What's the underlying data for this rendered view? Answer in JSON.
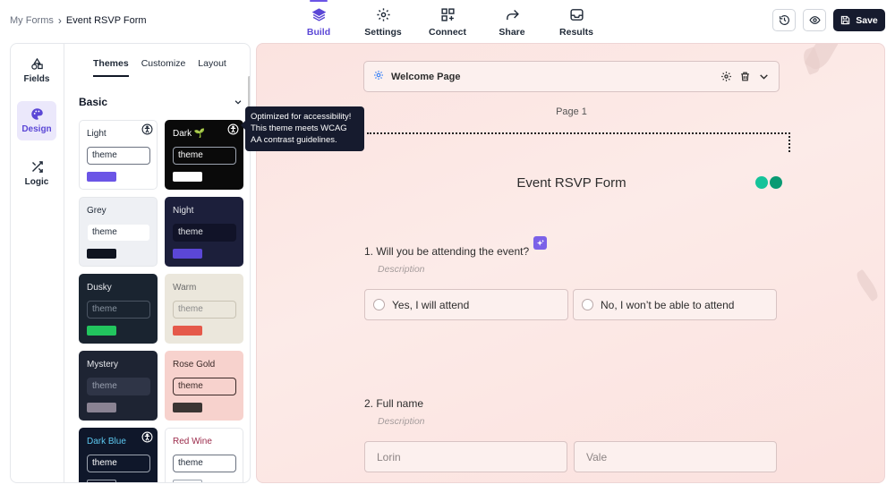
{
  "breadcrumb": {
    "root": "My Forms",
    "separator": "›",
    "current": "Event RSVP Form"
  },
  "nav": {
    "tabs": [
      {
        "label": "Build",
        "icon": "layers-icon",
        "active": true
      },
      {
        "label": "Settings",
        "icon": "gear-icon"
      },
      {
        "label": "Connect",
        "icon": "grid-plus-icon"
      },
      {
        "label": "Share",
        "icon": "share-arrow-icon"
      },
      {
        "label": "Results",
        "icon": "inbox-icon"
      }
    ]
  },
  "actions": {
    "history_icon": "history-icon",
    "preview_icon": "eye-icon",
    "save_label": "Save"
  },
  "rail": {
    "items": [
      {
        "label": "Fields",
        "icon": "shapes-icon"
      },
      {
        "label": "Design",
        "icon": "palette-icon",
        "active": true
      },
      {
        "label": "Logic",
        "icon": "shuffle-icon"
      }
    ]
  },
  "subtabs": [
    {
      "label": "Themes",
      "active": true
    },
    {
      "label": "Customize"
    },
    {
      "label": "Layout"
    }
  ],
  "section": {
    "title": "Basic"
  },
  "themes": [
    {
      "name": "Light",
      "input": "theme",
      "accessible": true,
      "bg": "#ffffff",
      "text": "#1f2937",
      "input_bg": "#ffffff",
      "input_border": "#6b7280",
      "input_text": "#1f2937",
      "swatch": "#6b55e6"
    },
    {
      "name": "Dark 🌱",
      "input": "theme",
      "accessible": true,
      "bg": "#0a0a0a",
      "text": "#ffffff",
      "input_bg": "#0a0a0a",
      "input_border": "#9ca3af",
      "input_text": "#ffffff",
      "swatch": "#ffffff"
    },
    {
      "name": "Grey",
      "input": "theme",
      "bg": "#eef0f4",
      "text": "#1f2937",
      "input_bg": "#ffffff",
      "input_border": "#eef0f4",
      "input_text": "#1f2937",
      "swatch": "#0f1420"
    },
    {
      "name": "Night",
      "input": "theme",
      "bg": "#1c1f3b",
      "text": "#e5e7eb",
      "input_bg": "#111328",
      "input_border": "#111328",
      "input_text": "#e5e7eb",
      "swatch": "#5b47d6"
    },
    {
      "name": "Dusky",
      "input": "theme",
      "bg": "#1a2430",
      "text": "#e5e7eb",
      "input_bg": "#1a2430",
      "input_border": "#4b5563",
      "input_text": "#8893a0",
      "swatch": "#22c55e"
    },
    {
      "name": "Warm",
      "input": "theme",
      "bg": "#ebe7dc",
      "text": "#6b6b6b",
      "input_bg": "#ebe7dc",
      "input_border": "#c9c3b4",
      "input_text": "#8a8a8a",
      "swatch": "#e5594a"
    },
    {
      "name": "Mystery",
      "input": "theme",
      "bg": "#1e2433",
      "text": "#e5e7eb",
      "input_bg": "#2f3547",
      "input_border": "#2f3547",
      "input_text": "#9aa1b0",
      "swatch": "#8a8393"
    },
    {
      "name": "Rose Gold",
      "input": "theme",
      "bg": "#f7d2cd",
      "text": "#3b2a28",
      "input_bg": "#f7d2cd",
      "input_border": "#3b2a28",
      "input_text": "#3b2a28",
      "swatch": "#3b3533"
    },
    {
      "name": "Dark Blue",
      "input": "theme",
      "accessible": true,
      "bg": "#0f172a",
      "text": "#5cc8f0",
      "input_bg": "#0f172a",
      "input_border": "#9ca3af",
      "input_text": "#ffffff",
      "swatch": "#0f172a"
    },
    {
      "name": "Red Wine",
      "input": "theme",
      "bg": "#ffffff",
      "text": "#9b2a4a",
      "input_bg": "#ffffff",
      "input_border": "#6b7280",
      "input_text": "#1f2937",
      "swatch": "#ffffff"
    }
  ],
  "tooltip": {
    "text": "Optimized for accessibility! This theme meets WCAG AA contrast guidelines."
  },
  "canvas": {
    "welcome": "Welcome Page",
    "page_label": "Page 1",
    "form_title": "Event RSVP Form",
    "q1": {
      "label": "1. Will you be attending the event?",
      "description": "Description",
      "options": [
        "Yes, I will attend",
        "No, I won’t be able to attend"
      ]
    },
    "q2": {
      "label": "2. Full name",
      "description": "Description",
      "fields": [
        "Lorin",
        "Vale"
      ]
    }
  },
  "colors": {
    "accent": "#6b55e6",
    "canvas_bg": "#fbe3e0"
  }
}
